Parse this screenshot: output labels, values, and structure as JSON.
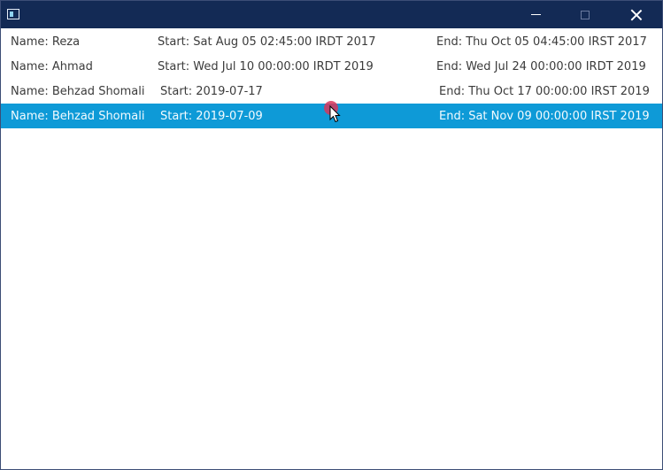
{
  "window": {
    "controls": [
      "minimize",
      "maximize",
      "close"
    ]
  },
  "rows": [
    {
      "name": "Name: Reza",
      "start": "Start: Sat Aug 05 02:45:00 IRDT 2017",
      "end": "End: Thu Oct 05 04:45:00 IRST 2017",
      "selected": false
    },
    {
      "name": "Name: Ahmad",
      "start": "Start: Wed Jul 10 00:00:00 IRDT 2019",
      "end": "End: Wed Jul 24 00:00:00 IRDT 2019",
      "selected": false
    },
    {
      "name": "Name: Behzad Shomali",
      "start": "Start: 2019-07-17",
      "end": "End: Thu Oct 17 00:00:00 IRST 2019",
      "selected": false
    },
    {
      "name": "Name: Behzad Shomali",
      "start": "Start: 2019-07-09",
      "end": "End: Sat Nov 09 00:00:00 IRST 2019",
      "selected": true
    }
  ],
  "colors": {
    "titlebar": "#132a55",
    "selection": "#0e9ad7",
    "text": "#3b3b3b",
    "selected_text": "#f3fbff",
    "cursor_highlight": "#d8365a"
  },
  "icons": [
    "app-icon",
    "minimize-icon",
    "maximize-icon",
    "close-icon",
    "mouse-cursor-icon"
  ]
}
